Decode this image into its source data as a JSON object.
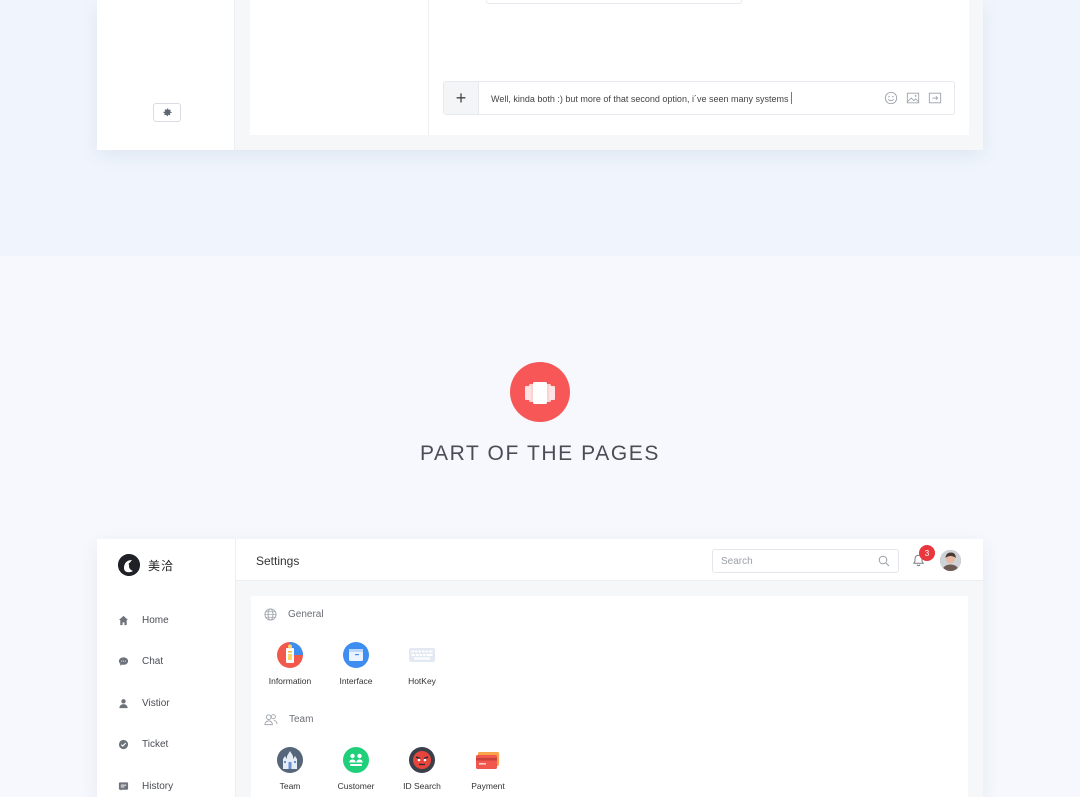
{
  "chat": {
    "composer_text": "Well, kinda both :) but more of that second option, i´ve seen many systems",
    "plus_label": "+"
  },
  "section": {
    "title": "PART OF THE PAGES",
    "accent_color": "#f75757"
  },
  "app": {
    "logo_text": "美洽",
    "nav": [
      {
        "label": "Home",
        "icon": "home-icon"
      },
      {
        "label": "Chat",
        "icon": "chat-bubble-icon"
      },
      {
        "label": "Vistior",
        "icon": "user-icon"
      },
      {
        "label": "Ticket",
        "icon": "check-circle-icon"
      },
      {
        "label": "History",
        "icon": "history-icon"
      }
    ],
    "header": {
      "title": "Settings",
      "search_placeholder": "Search",
      "notification_count": "3"
    },
    "groups": [
      {
        "title": "General",
        "icon": "globe-icon",
        "items": [
          {
            "label": "Information"
          },
          {
            "label": "Interface"
          },
          {
            "label": "HotKey"
          }
        ]
      },
      {
        "title": "Team",
        "icon": "team-icon",
        "items": [
          {
            "label": "Team"
          },
          {
            "label": "Customer"
          },
          {
            "label": "ID Search"
          },
          {
            "label": "Payment"
          }
        ]
      }
    ]
  }
}
